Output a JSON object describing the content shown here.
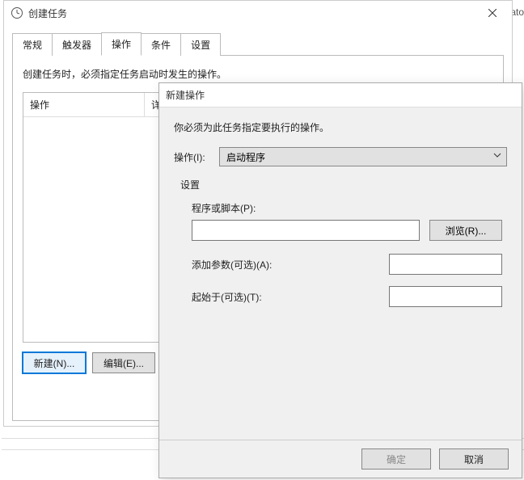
{
  "edge_text": "trato",
  "parent": {
    "title": "创建任务",
    "tabs": [
      "常规",
      "触发器",
      "操作",
      "条件",
      "设置"
    ],
    "active_tab_index": 2,
    "hint": "创建任务时，必须指定任务启动时发生的操作。",
    "columns": {
      "action": "操作",
      "details": "详细信息"
    },
    "buttons": {
      "new": "新建(N)...",
      "edit": "编辑(E)..."
    }
  },
  "child": {
    "title": "新建操作",
    "hint": "你必须为此任务指定要执行的操作。",
    "action_label": "操作(I):",
    "action_value": "启动程序",
    "settings_group": "设置",
    "program_label": "程序或脚本(P):",
    "program_value": "",
    "browse": "浏览(R)...",
    "args_label": "添加参数(可选)(A):",
    "args_value": "",
    "startin_label": "起始于(可选)(T):",
    "startin_value": "",
    "ok": "确定",
    "cancel": "取消"
  }
}
